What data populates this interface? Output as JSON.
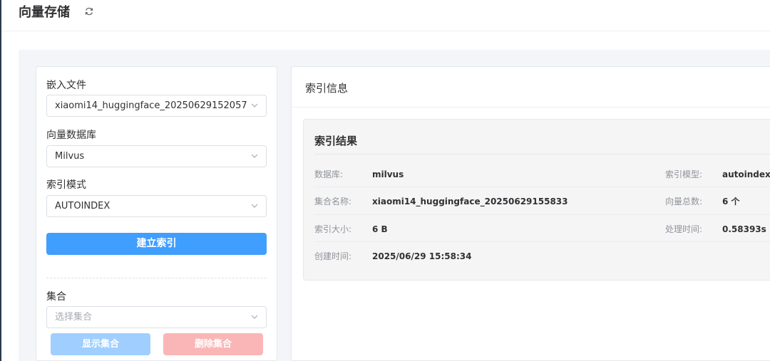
{
  "header": {
    "title": "向量存储",
    "refresh_icon": "refresh-icon"
  },
  "left_panel": {
    "embed_file": {
      "label": "嵌入文件",
      "value": "xiaomi14_huggingface_20250629152057.js..."
    },
    "vector_db": {
      "label": "向量数据库",
      "value": "Milvus"
    },
    "index_mode": {
      "label": "索引模式",
      "value": "AUTOINDEX"
    },
    "build_index_button": "建立索引",
    "collection": {
      "label": "集合",
      "placeholder": "选择集合"
    },
    "show_collection_button": "显示集合",
    "delete_collection_button": "删除集合"
  },
  "right_panel": {
    "title": "索引信息",
    "result": {
      "title": "索引结果",
      "database_label": "数据库:",
      "database_value": "milvus",
      "index_model_label": "索引模型:",
      "index_model_value": "autoindex",
      "collection_name_label": "集合名称:",
      "collection_name_value": "xiaomi14_huggingface_20250629155833",
      "vector_count_label": "向量总数:",
      "vector_count_value": "6 个",
      "index_size_label": "索引大小:",
      "index_size_value": "6 B",
      "process_time_label": "处理时间:",
      "process_time_value": "0.58393s",
      "created_time_label": "创建时间:",
      "created_time_value": "2025/06/29 15:58:34"
    }
  },
  "colors": {
    "primary": "#409eff",
    "primary_disabled": "#a0cfff",
    "danger_disabled": "#fab6b6",
    "background": "#f3f5f8"
  }
}
